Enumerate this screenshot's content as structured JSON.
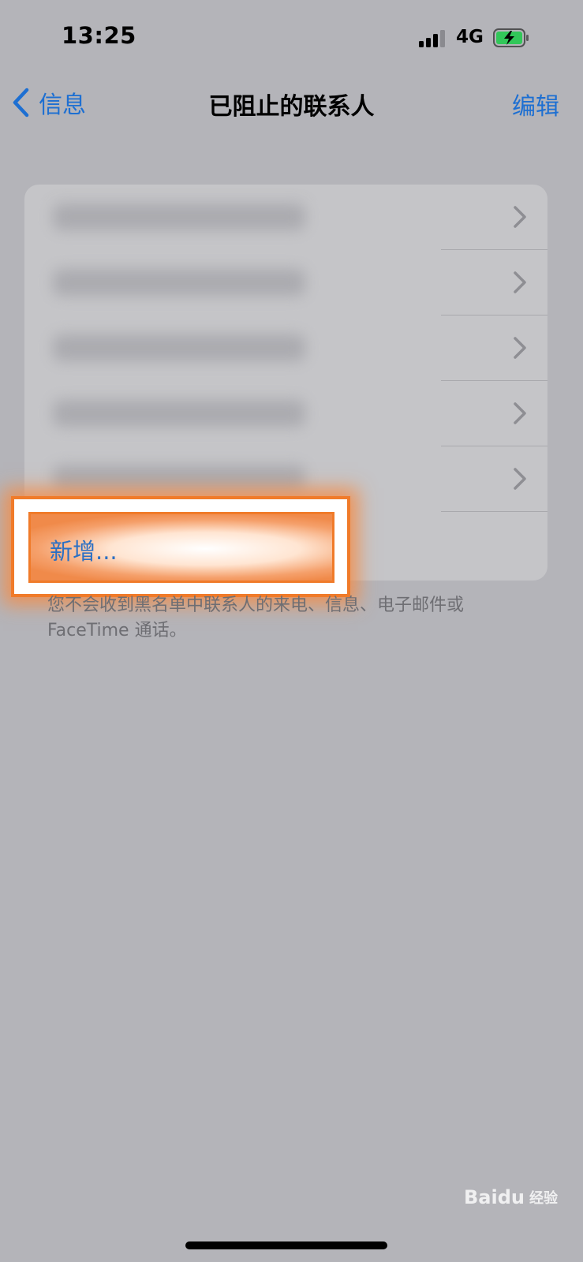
{
  "status_bar": {
    "time": "13:25",
    "network": "4G",
    "battery_charging": true,
    "battery_color": "#32c759",
    "signal_bars_filled": 3
  },
  "nav": {
    "back_label": "信息",
    "title": "已阻止的联系人",
    "edit_label": "编辑",
    "accent_color": "#1d6fd2"
  },
  "blocked_contacts": {
    "row_count": 5,
    "rows_obscured": true
  },
  "add_button": {
    "label": "新增..."
  },
  "footer_note": "您不会收到黑名单中联系人的来电、信息、电子邮件或FaceTime 通话。",
  "watermark": {
    "text": "Bai",
    "text2": "du",
    "sub": "经验",
    "url": "jingyan.baidu.com"
  },
  "highlight_color": "#f07b2a"
}
